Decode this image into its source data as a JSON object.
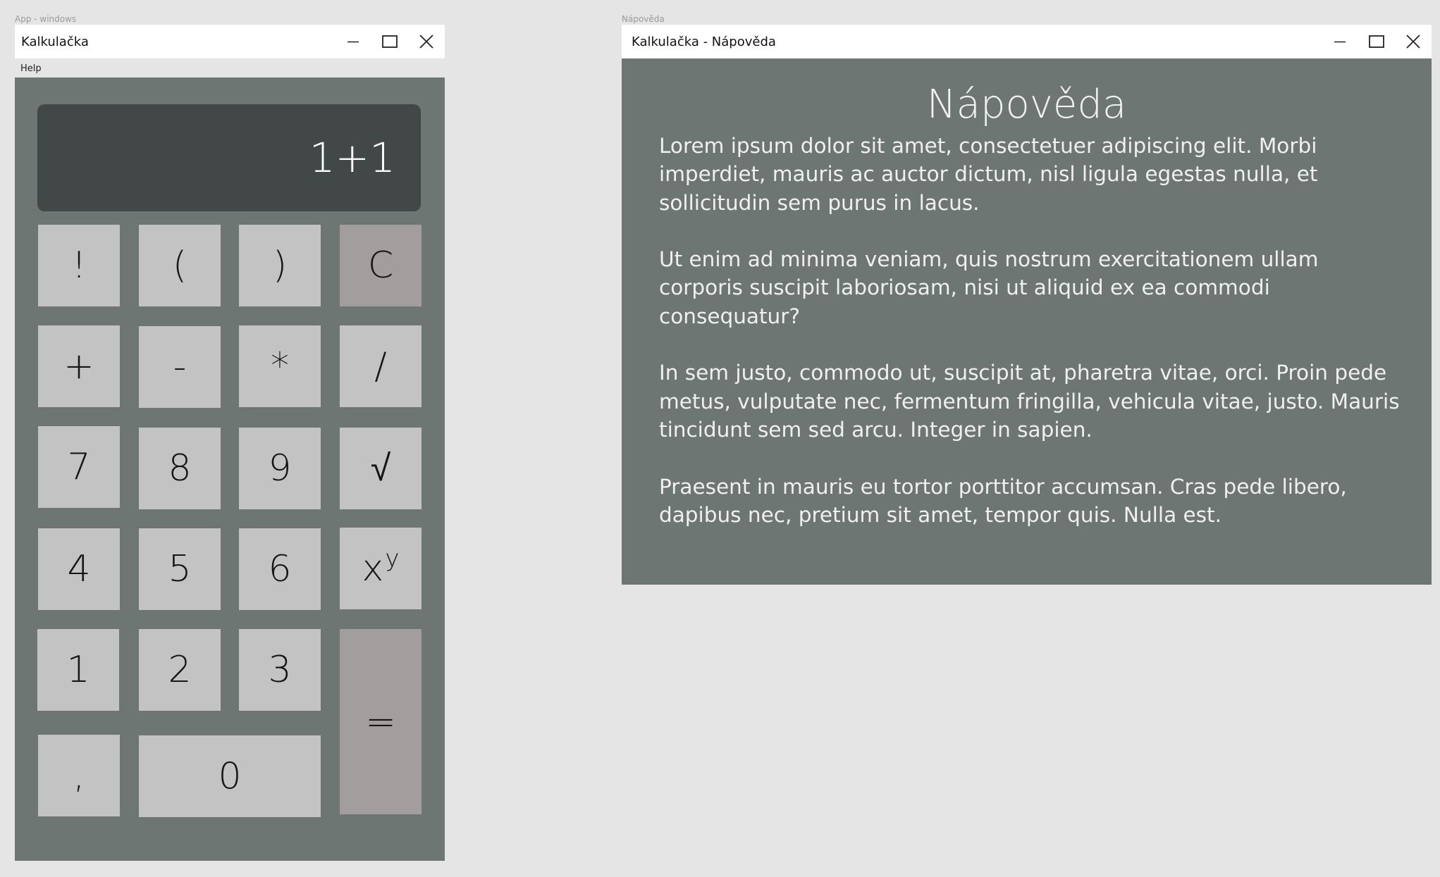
{
  "calc_frame_label": "App - windows",
  "help_frame_label": "Nápověda",
  "calculator": {
    "title": "Kalkulačka",
    "menu": [
      "Help"
    ],
    "display": "1+1",
    "keys": {
      "fact": "!",
      "lparen": "(",
      "rparen": ")",
      "clear": "C",
      "plus": "+",
      "minus": "-",
      "multiply": "*",
      "divide": "/",
      "d7": "7",
      "d8": "8",
      "d9": "9",
      "sqrt": "√",
      "d4": "4",
      "d5": "5",
      "d6": "6",
      "pow_base": "x",
      "pow_exp": "y",
      "d1": "1",
      "d2": "2",
      "d3": "3",
      "equals": "=",
      "comma": ",",
      "d0": "0"
    }
  },
  "help_window": {
    "title": "Kalkulačka - Nápověda",
    "heading": "Nápověda",
    "paragraphs": [
      "Lorem ipsum dolor sit amet, consectetuer adipiscing elit. Morbi imperdiet, mauris ac auctor dictum, nisl ligula egestas nulla, et sollicitudin sem purus in lacus.",
      "Ut enim ad minima veniam, quis nostrum exercitationem ullam corporis suscipit laboriosam, nisi ut aliquid ex ea commodi consequatur?",
      "In sem justo, commodo ut, suscipit at, pharetra vitae, orci. Proin pede metus, vulputate nec, fermentum fringilla, vehicula vitae, justo. Mauris tincidunt sem sed arcu. Integer in sapien.",
      "Praesent in mauris eu tortor porttitor accumsan. Cras pede libero, dapibus nec, pretium sit amet, tempor quis. Nulla est."
    ]
  },
  "window_controls": [
    "minimize-icon",
    "maximize-icon",
    "close-icon"
  ],
  "colors": {
    "desktop": "#e5e5e5",
    "panel": "#6d7672",
    "display": "#414847",
    "key": "#c3c3c3",
    "key_accent": "#a39e9e"
  }
}
